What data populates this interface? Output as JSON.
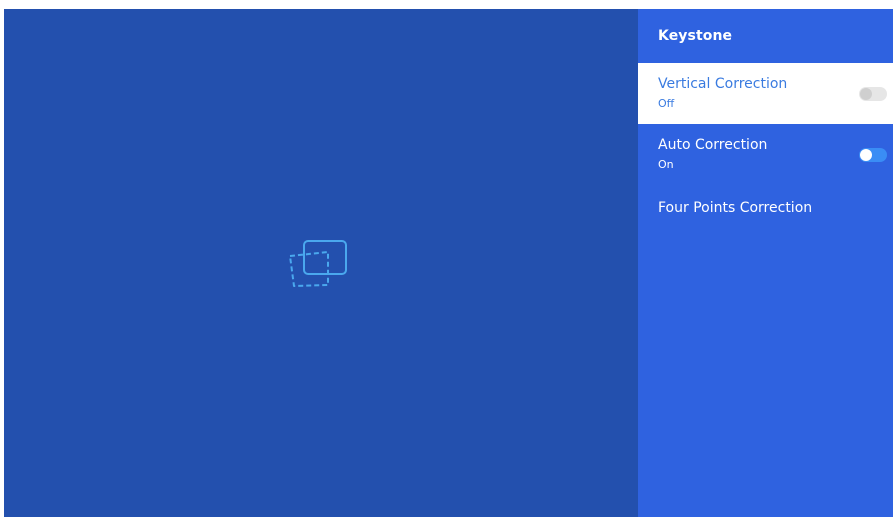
{
  "panel": {
    "title": "Keystone",
    "items": [
      {
        "label": "Vertical Correction",
        "status": "Off",
        "toggle": "off",
        "selected": true
      },
      {
        "label": "Auto Correction",
        "status": "On",
        "toggle": "on",
        "selected": false
      },
      {
        "label": "Four Points Correction",
        "selected": false
      }
    ]
  },
  "icons": {
    "center_graphic": "keystone-correction-icon"
  },
  "colors": {
    "main_background": "#2350ae",
    "panel_background": "#2f62e0",
    "selected_text": "#3a7be0",
    "toggle_on": "#3a8df5",
    "icon_stroke": "#4aa8ee"
  }
}
